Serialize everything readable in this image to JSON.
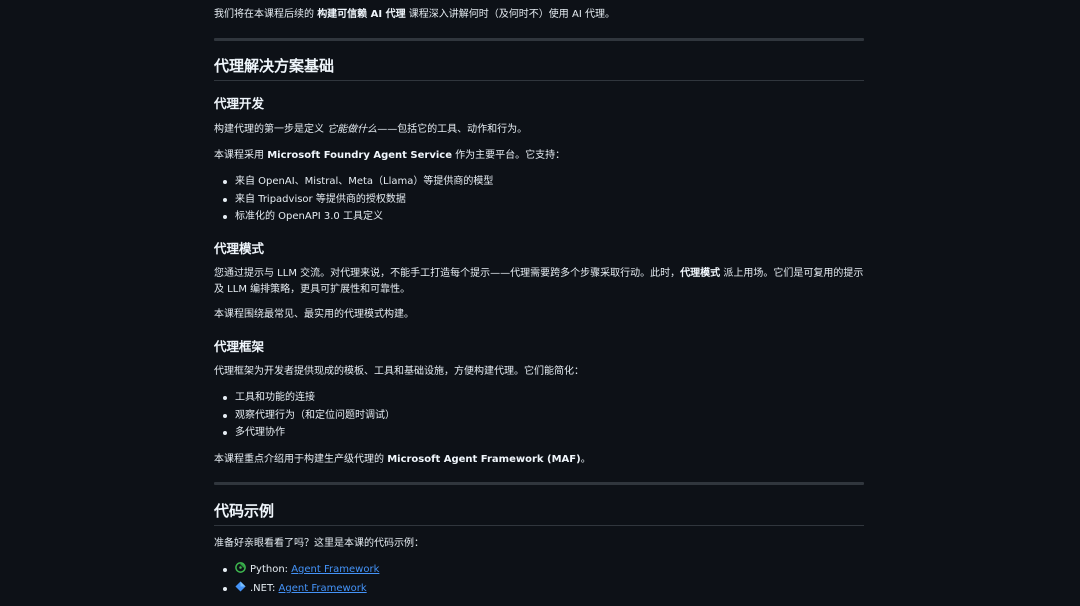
{
  "intro": {
    "prefix": "我们将在本课程后续的 ",
    "bold": "构建可信赖 AI 代理",
    "suffix": " 课程深入讲解何时（及何时不）使用 AI 代理。"
  },
  "section_basics": {
    "title": "代理解决方案基础",
    "dev": {
      "title": "代理开发",
      "p1_prefix": "构建代理的第一步是定义 ",
      "p1_italic": "它能做什么",
      "p1_suffix": "——包括它的工具、动作和行为。",
      "p2_prefix": "本课程采用 ",
      "p2_bold": "Microsoft Foundry Agent Service",
      "p2_suffix": " 作为主要平台。它支持：",
      "items": [
        "来自 OpenAI、Mistral、Meta（Llama）等提供商的模型",
        "来自 Tripadvisor 等提供商的授权数据",
        "标准化的 OpenAPI 3.0 工具定义"
      ]
    },
    "patterns": {
      "title": "代理模式",
      "p1_prefix": "您通过提示与 LLM 交流。对代理来说，不能手工打造每个提示——代理需要跨多个步骤采取行动。此时，",
      "p1_bold": "代理模式",
      "p1_suffix": " 派上用场。它们是可复用的提示及 LLM 编排策略，更具可扩展性和可靠性。",
      "p2": "本课程围绕最常见、最实用的代理模式构建。"
    },
    "frameworks": {
      "title": "代理框架",
      "p1": "代理框架为开发者提供现成的模板、工具和基础设施，方便构建代理。它们能简化：",
      "items": [
        "工具和功能的连接",
        "观察代理行为（和定位问题时调试）",
        "多代理协作"
      ],
      "p2_prefix": "本课程重点介绍用于构建生产级代理的 ",
      "p2_bold": "Microsoft Agent Framework (MAF)",
      "p2_suffix": "。"
    }
  },
  "section_code": {
    "title": "代码示例",
    "p1": "准备好亲眼看看了吗？这里是本课的代码示例：",
    "links": [
      {
        "prefix": "Python: ",
        "link": "Agent Framework",
        "icon": "python-icon"
      },
      {
        "prefix": ".NET: ",
        "link": "Agent Framework",
        "icon": "dotnet-diamond-icon"
      }
    ]
  },
  "colors": {
    "background": "#0d1117",
    "text": "#e6edf3",
    "link": "#4493f8",
    "divider": "#30363d"
  }
}
